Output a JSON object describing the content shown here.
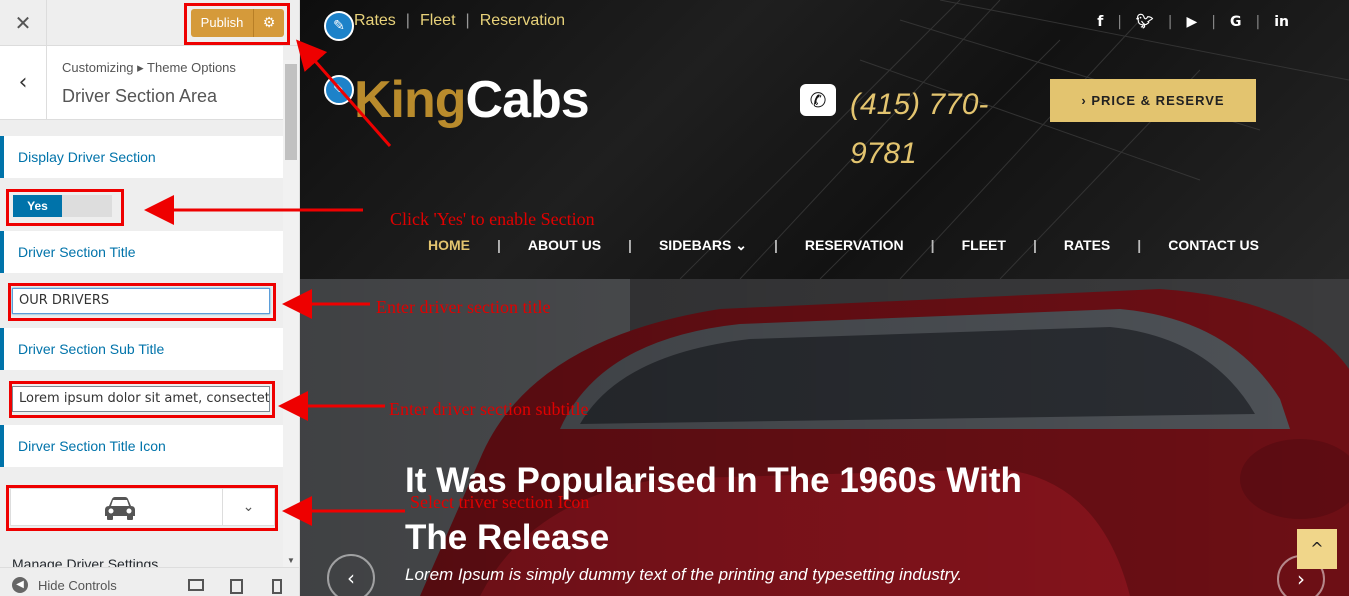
{
  "customizer": {
    "close_icon": "close-icon",
    "publish_label": "Publish",
    "settings_icon": "gear-icon",
    "breadcrumb": "Customizing ▸ Theme Options",
    "section_title": "Driver Section Area",
    "controls": {
      "display_label": "Display Driver Section",
      "toggle_value": "Yes",
      "title_label": "Driver Section Title",
      "title_value": "OUR DRIVERS",
      "subtitle_label": "Driver Section Sub Title",
      "subtitle_value": "Lorem ipsum dolor sit amet, consectetur",
      "icon_label": "Dirver Section Title Icon",
      "icon_value": "car-icon",
      "manage_label": "Manage Driver Settings"
    },
    "footer": {
      "hide_controls": "Hide Controls"
    }
  },
  "site": {
    "topnav": [
      "Rates",
      "Fleet",
      "Reservation"
    ],
    "social_icons": [
      "facebook-icon",
      "twitter-icon",
      "youtube-icon",
      "google-icon",
      "linkedin-icon"
    ],
    "logo_king": "King",
    "logo_cabs": "Cabs",
    "phone": "(415) 770-9781",
    "price_button": "PRICE & RESERVE",
    "mainnav": [
      "HOME",
      "ABOUT US",
      "SIDEBARS",
      "RESERVATION",
      "FLEET",
      "RATES",
      "CONTACT US"
    ],
    "hero_title": "It Was Popularised In The 1960s With The Release",
    "hero_subtitle": "Lorem Ipsum is simply dummy text of the printing and typesetting industry."
  },
  "annotations": {
    "toggle_note": "Click 'Yes' to enable Section",
    "title_note": "Enter driver section title",
    "subtitle_note": "Enter driver section subtitle",
    "icon_note": "Select triver section Icon"
  },
  "colors": {
    "accent_blue": "#0073aa",
    "publish_orange": "#d59a3a",
    "gold": "#e3c46f",
    "annotation_red": "#ee0000"
  }
}
